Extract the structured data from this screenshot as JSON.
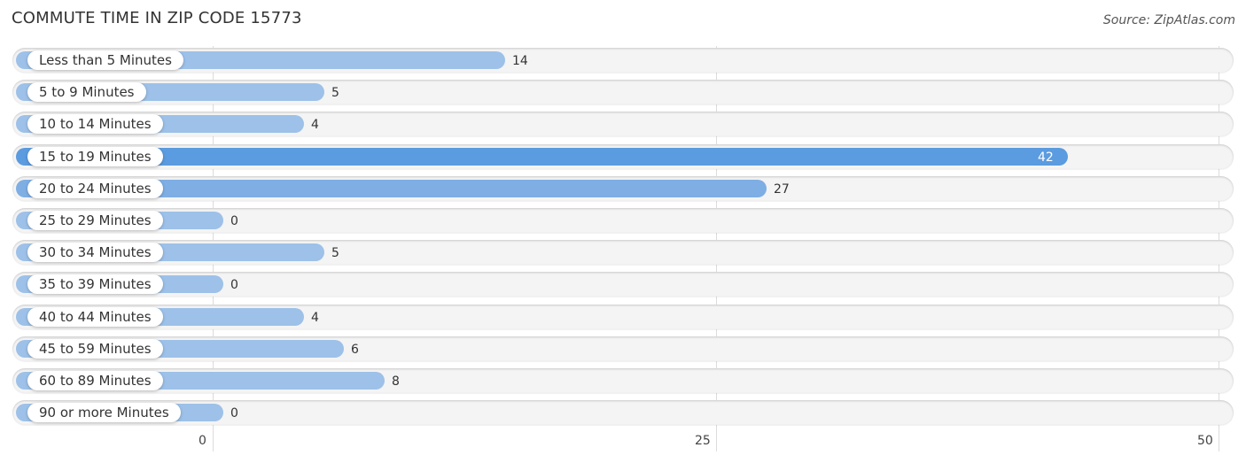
{
  "chart_data": {
    "type": "bar",
    "orientation": "horizontal",
    "title": "COMMUTE TIME IN ZIP CODE 15773",
    "source": "Source: ZipAtlas.com",
    "xlabel": "",
    "ylabel": "",
    "xlim": [
      0,
      50
    ],
    "xticks": [
      0,
      25,
      50
    ],
    "grid": true,
    "categories": [
      "Less than 5 Minutes",
      "5 to 9 Minutes",
      "10 to 14 Minutes",
      "15 to 19 Minutes",
      "20 to 24 Minutes",
      "25 to 29 Minutes",
      "30 to 34 Minutes",
      "35 to 39 Minutes",
      "40 to 44 Minutes",
      "45 to 59 Minutes",
      "60 to 89 Minutes",
      "90 or more Minutes"
    ],
    "values": [
      14,
      5,
      4,
      42,
      27,
      0,
      5,
      0,
      4,
      6,
      8,
      0
    ],
    "colors": {
      "bar": "#9dc1e8",
      "bar_highlight": "#5b9bdf",
      "bar_mid": "#7eaee3",
      "row_background": "#f4f4f4"
    }
  }
}
